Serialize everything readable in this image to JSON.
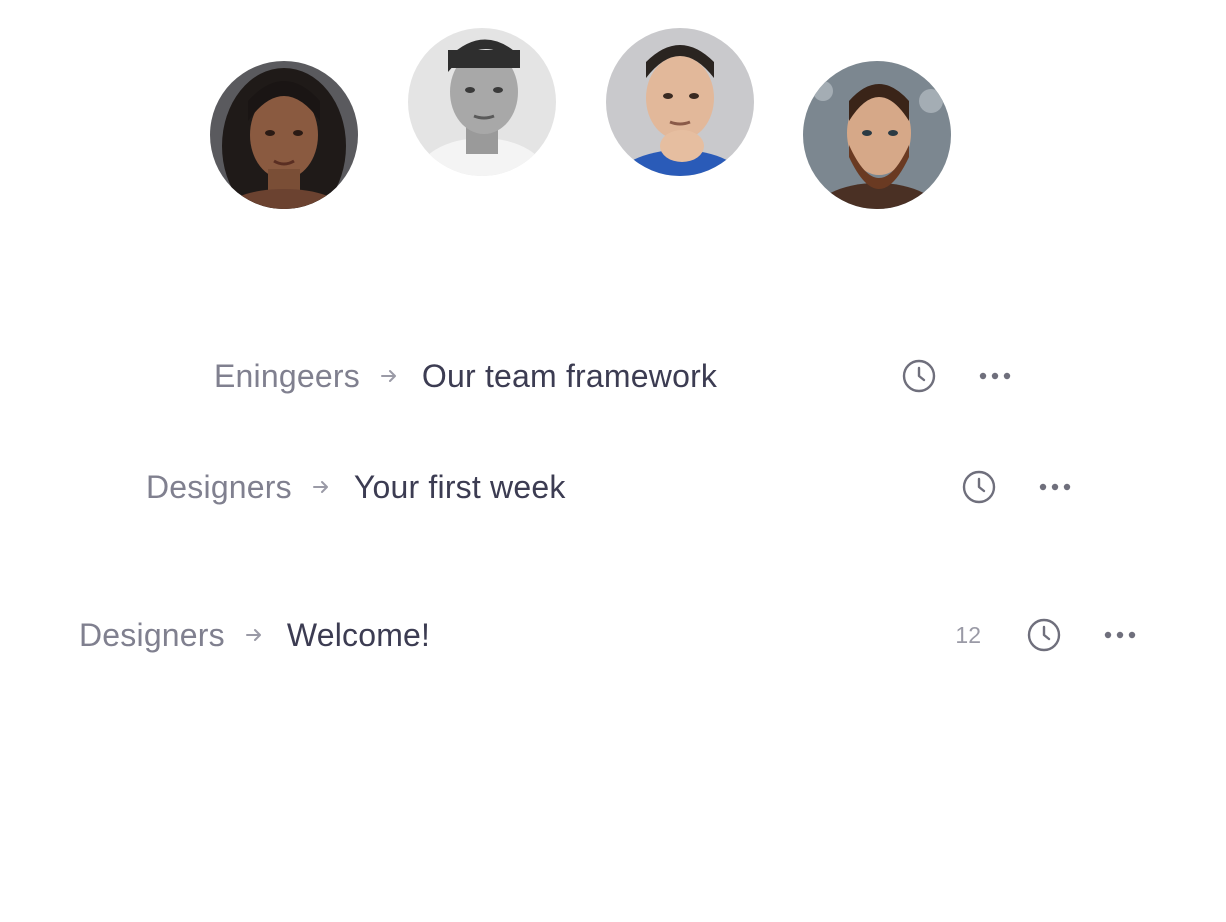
{
  "colors": {
    "parent_text": "#80808f",
    "title_text": "#3c3c52",
    "icon": "#6f6f7c",
    "count_text": "#9a9aa6"
  },
  "avatars": [
    {
      "name": "avatar-1",
      "icon": "person-photo"
    },
    {
      "name": "avatar-2",
      "icon": "person-photo"
    },
    {
      "name": "avatar-3",
      "icon": "person-photo"
    },
    {
      "name": "avatar-4",
      "icon": "person-photo"
    }
  ],
  "rows": [
    {
      "parent": "Eningeers",
      "title": "Our team framework",
      "count": null,
      "icons": [
        "arrow-right-icon",
        "clock-icon",
        "more-icon"
      ]
    },
    {
      "parent": "Designers",
      "title": "Your first week",
      "count": null,
      "icons": [
        "arrow-right-icon",
        "clock-icon",
        "more-icon"
      ]
    },
    {
      "parent": "Designers",
      "title": "Welcome!",
      "count": "12",
      "icons": [
        "arrow-right-icon",
        "clock-icon",
        "more-icon"
      ]
    }
  ]
}
